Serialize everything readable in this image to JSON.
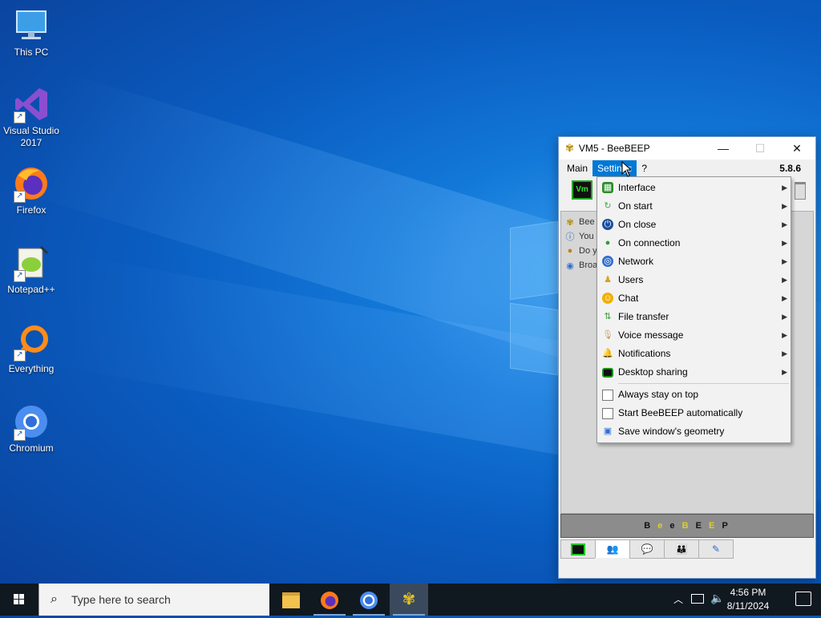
{
  "desktop": {
    "icons": [
      {
        "label": "This PC"
      },
      {
        "label": "Visual Studio 2017"
      },
      {
        "label": "Firefox"
      },
      {
        "label": "Notepad++"
      },
      {
        "label": "Everything"
      },
      {
        "label": "Chromium"
      }
    ]
  },
  "window": {
    "title": "VM5 - BeeBEEP",
    "app_icon": "bee-icon",
    "controls": {
      "minimize": "—",
      "maximize": "☐",
      "close": "✕"
    },
    "menubar": {
      "main": "Main",
      "settings": "Settings",
      "help": "?",
      "version": "5.8.6"
    },
    "toolbar": {
      "vm_badge": "Vm"
    },
    "content_rows": [
      {
        "text": "Bee",
        "icon": "bee-icon"
      },
      {
        "text": "You",
        "icon": "info-icon"
      },
      {
        "text": "Do y",
        "icon": "question-icon"
      },
      {
        "text": "Broa",
        "icon": "broadcast-icon"
      }
    ],
    "banner": [
      "B",
      "e",
      "e",
      "B",
      "E",
      "E",
      "P"
    ],
    "tabs": [
      "home-tab-icon",
      "users-tab-icon",
      "chat-tab-icon",
      "groups-tab-icon",
      "files-tab-icon"
    ]
  },
  "settings_menu": {
    "submenus": [
      {
        "label": "Interface",
        "icon": "interface-icon",
        "color": "#2e8b2e"
      },
      {
        "label": "On start",
        "icon": "on-start-icon",
        "color": "#4aa84a"
      },
      {
        "label": "On close",
        "icon": "on-close-icon",
        "color": "#1a4fa0"
      },
      {
        "label": "On connection",
        "icon": "on-connection-icon",
        "color": "#2f9e2f"
      },
      {
        "label": "Network",
        "icon": "network-icon",
        "color": "#2f6fd0"
      },
      {
        "label": "Users",
        "icon": "users-icon",
        "color": "#d9a020"
      },
      {
        "label": "Chat",
        "icon": "chat-icon",
        "color": "#f0b000"
      },
      {
        "label": "File transfer",
        "icon": "file-transfer-icon",
        "color": "#3c9c3c"
      },
      {
        "label": "Voice message",
        "icon": "voice-message-icon",
        "color": "#c8a070"
      },
      {
        "label": "Notifications",
        "icon": "notifications-icon",
        "color": "#e0a000"
      },
      {
        "label": "Desktop sharing",
        "icon": "desktop-sharing-icon",
        "color": "#1f8f1f"
      }
    ],
    "options": [
      {
        "label": "Always stay on top",
        "checked": false
      },
      {
        "label": "Start BeeBEEP automatically",
        "checked": false
      }
    ],
    "action": {
      "label": "Save window's geometry",
      "icon": "save-geometry-icon"
    }
  },
  "taskbar": {
    "search_placeholder": "Type here to search",
    "apps": [
      "file-explorer-icon",
      "firefox-icon",
      "chromium-icon",
      "beebeep-icon"
    ],
    "clock_time": "4:56 PM",
    "clock_date": "8/11/2024"
  }
}
